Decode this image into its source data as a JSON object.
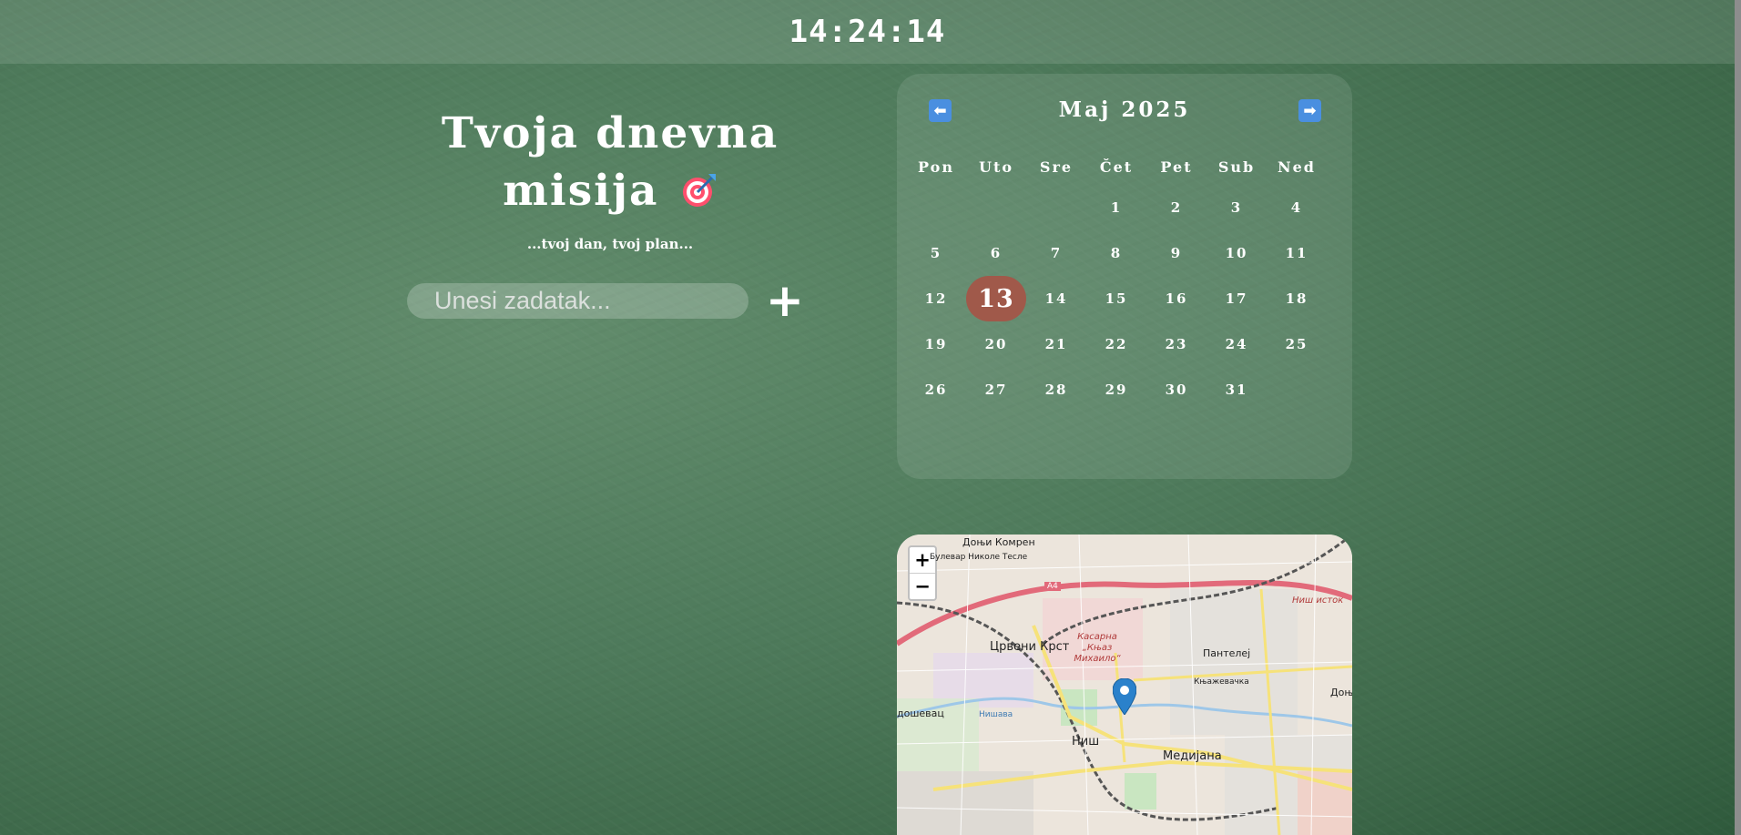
{
  "clock": {
    "time": "14:24:14"
  },
  "mission": {
    "title_line1": "Tvoja dnevna",
    "title_line2": "misija",
    "subtitle": "...tvoj dan, tvoj plan...",
    "input_placeholder": "Unesi zadatak...",
    "add_label": "+"
  },
  "calendar": {
    "prev_label": "⬅",
    "next_label": "➡",
    "month_title": "Maj 2025",
    "weekdays": [
      "Pon",
      "Uto",
      "Sre",
      "Čet",
      "Pet",
      "Sub",
      "Ned"
    ],
    "days": [
      "",
      "",
      "",
      "1",
      "2",
      "3",
      "4",
      "5",
      "6",
      "7",
      "8",
      "9",
      "10",
      "11",
      "12",
      "13",
      "14",
      "15",
      "16",
      "17",
      "18",
      "19",
      "20",
      "21",
      "22",
      "23",
      "24",
      "25",
      "26",
      "27",
      "28",
      "29",
      "30",
      "31",
      ""
    ],
    "today": "13",
    "today_color": "#a0594a"
  },
  "map": {
    "zoom_in": "+",
    "zoom_out": "−",
    "labels": {
      "donji_komren": "Доњи Комрен",
      "bulevar": "Булевар Николе Тесле",
      "a4": "A4",
      "nisistok": "Ниш исток",
      "kasarna": "Касарна „Књаз Михаило“",
      "crveni_krst": "Црвени Крст",
      "pantelej": "Пантелеј",
      "knjazevacka": "Књажевачка",
      "nis": "Ниш",
      "medijana": "Медијана",
      "nisava": "Нишава",
      "dosevac": "дошевац",
      "donja": "Доњ"
    }
  },
  "colors": {
    "board": "#4e7a5b",
    "marker": "#2a81cb"
  }
}
